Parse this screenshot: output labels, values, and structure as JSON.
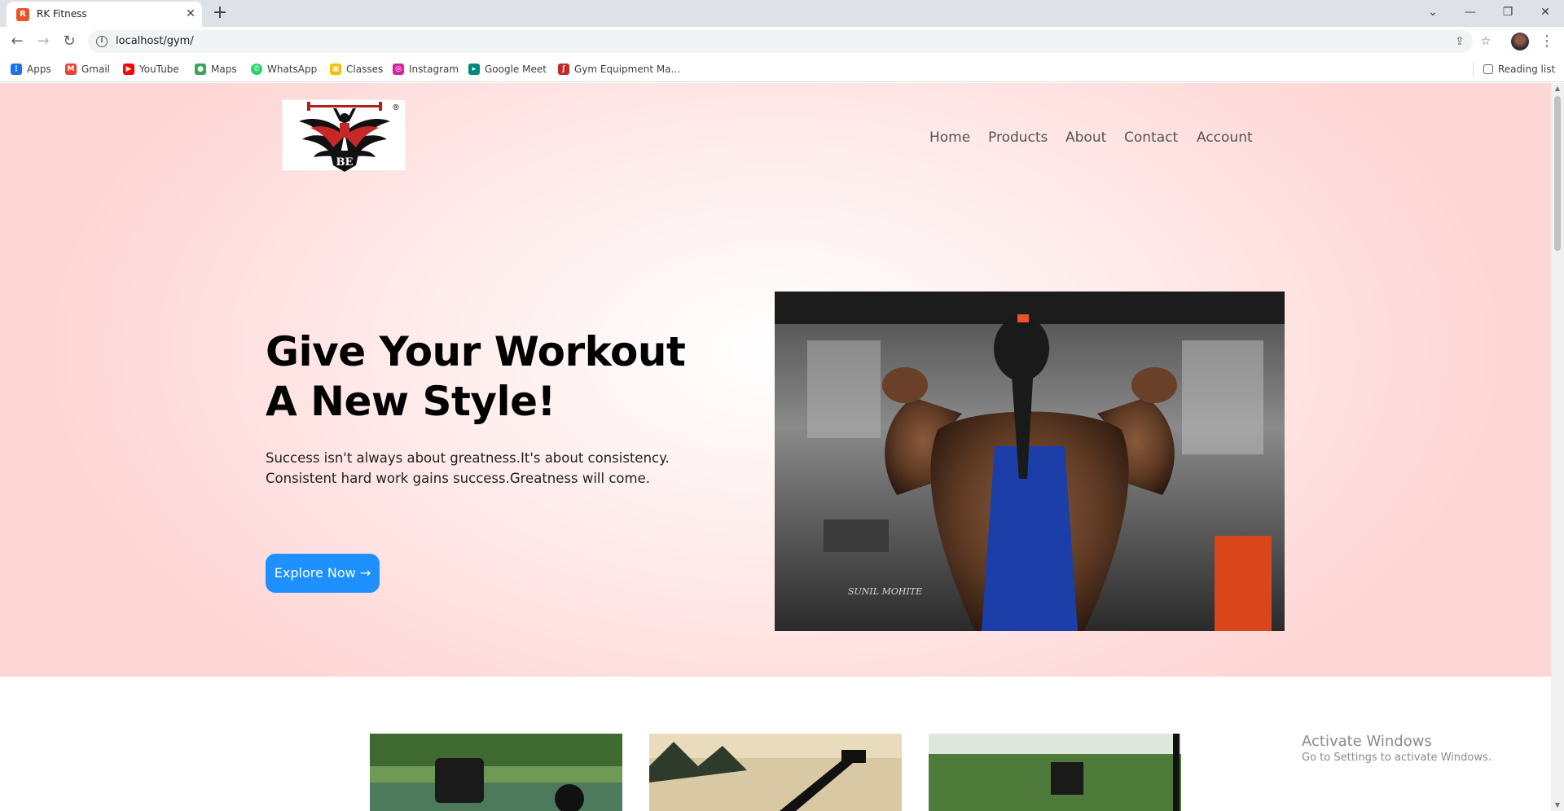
{
  "browser": {
    "tab_title": "RK Fitness",
    "tab_favicon_letter": "R",
    "url": "localhost/gym/",
    "bookmarks": [
      {
        "label": "Apps",
        "icon": "apps-grid-icon",
        "color": "#1a73e8"
      },
      {
        "label": "Gmail",
        "icon": "gmail-icon",
        "color": "#ea4335"
      },
      {
        "label": "YouTube",
        "icon": "youtube-icon",
        "color": "#ff0000"
      },
      {
        "label": "Maps",
        "icon": "maps-pin-icon",
        "color": "#34a853"
      },
      {
        "label": "WhatsApp",
        "icon": "whatsapp-icon",
        "color": "#25d366"
      },
      {
        "label": "Classes",
        "icon": "classroom-icon",
        "color": "#fbbc04"
      },
      {
        "label": "Instagram",
        "icon": "instagram-icon",
        "color": "#d6249f"
      },
      {
        "label": "Google Meet",
        "icon": "meet-icon",
        "color": "#00897b"
      },
      {
        "label": "Gym Equipment Ma...",
        "icon": "gym-equipment-icon",
        "color": "#c62828"
      }
    ],
    "reading_list": "Reading list"
  },
  "site": {
    "nav": [
      "Home",
      "Products",
      "About",
      "Contact",
      "Account"
    ],
    "hero": {
      "title_line1": "Give Your Workout",
      "title_line2": "A New Style!",
      "text": "Success isn't always about greatness.It's about consistency. Consistent hard work gains success.Greatness will come.",
      "button": "Explore Now →",
      "image_watermark": "SUNIL MOHITE",
      "logo_initials": "BE",
      "logo_mark": "®"
    },
    "accent_color": "#1e90ff"
  },
  "os": {
    "activate_line1": "Activate Windows",
    "activate_line2": "Go to Settings to activate Windows."
  }
}
